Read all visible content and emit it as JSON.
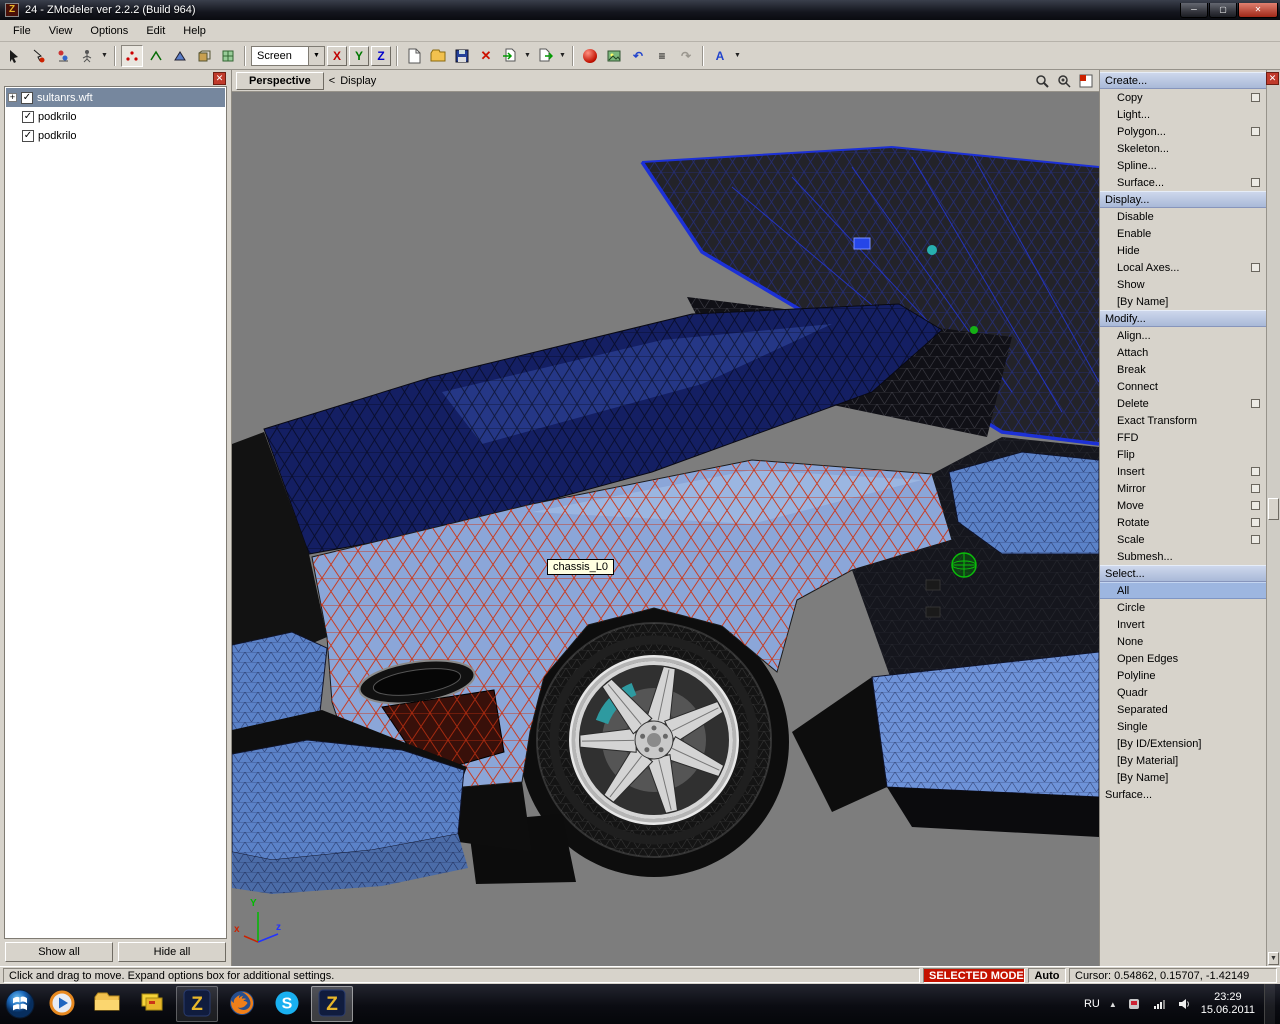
{
  "window": {
    "title": "24 - ZModeler ver 2.2.2 (Build 964)"
  },
  "menu": {
    "items": [
      "File",
      "View",
      "Options",
      "Edit",
      "Help"
    ]
  },
  "toolbar": {
    "screen_mode": "Screen",
    "axis_x": "X",
    "axis_y": "Y",
    "axis_z": "Z",
    "font_button": "A",
    "left_icons": [
      "select-arrow-icon",
      "lasso-select-icon",
      "paint-select-icon",
      "skeleton-pose-icon",
      "vertices-mode-icon",
      "edges-mode-icon",
      "faces-mode-icon",
      "objects-mode-icon",
      "uv-mode-icon"
    ],
    "right_icons": [
      "new-file-icon",
      "open-file-icon",
      "save-file-icon",
      "delete-icon",
      "import-icon",
      "export-icon",
      "material-editor-icon",
      "texture-icon",
      "undo-icon",
      "history-icon",
      "redo-icon",
      "font-icon"
    ]
  },
  "scene_tree": {
    "items": [
      {
        "label": "sultanrs.wft",
        "checked": true,
        "selected": true,
        "expandable": true
      },
      {
        "label": "podkrilo",
        "checked": true
      },
      {
        "label": "podkrilo",
        "checked": true
      }
    ],
    "show_all": "Show all",
    "hide_all": "Hide all"
  },
  "viewport": {
    "view_button": "Perspective",
    "back_arrow": "<",
    "mode_label": "Display",
    "tooltip": "chassis_L0",
    "axis": {
      "x": "x",
      "y": "Y",
      "z": "z"
    },
    "header_icons": [
      "zoom-icon",
      "zoom-extents-icon",
      "viewport-layout-icon"
    ]
  },
  "command_panel": {
    "items": [
      {
        "label": "Create...",
        "header": true
      },
      {
        "label": "Copy",
        "checkbox": true
      },
      {
        "label": "Light..."
      },
      {
        "label": "Polygon...",
        "checkbox": true
      },
      {
        "label": "Skeleton..."
      },
      {
        "label": "Spline..."
      },
      {
        "label": "Surface...",
        "checkbox": true
      },
      {
        "label": "Display...",
        "header": true
      },
      {
        "label": "Disable"
      },
      {
        "label": "Enable"
      },
      {
        "label": "Hide"
      },
      {
        "label": "Local Axes...",
        "checkbox": true
      },
      {
        "label": "Show"
      },
      {
        "label": "[By Name]"
      },
      {
        "label": "Modify...",
        "header": true
      },
      {
        "label": "Align..."
      },
      {
        "label": "Attach"
      },
      {
        "label": "Break"
      },
      {
        "label": "Connect"
      },
      {
        "label": "Delete",
        "checkbox": true
      },
      {
        "label": "Exact Transform"
      },
      {
        "label": "FFD"
      },
      {
        "label": "Flip"
      },
      {
        "label": "Insert",
        "checkbox": true
      },
      {
        "label": "Mirror",
        "checkbox": true
      },
      {
        "label": "Move",
        "checkbox": true
      },
      {
        "label": "Rotate",
        "checkbox": true
      },
      {
        "label": "Scale",
        "checkbox": true
      },
      {
        "label": "Submesh..."
      },
      {
        "label": "Select...",
        "header": true
      },
      {
        "label": "All",
        "selected": true
      },
      {
        "label": "Circle"
      },
      {
        "label": "Invert"
      },
      {
        "label": "None"
      },
      {
        "label": "Open Edges"
      },
      {
        "label": "Polyline"
      },
      {
        "label": "Quadr"
      },
      {
        "label": "Separated"
      },
      {
        "label": "Single"
      },
      {
        "label": "[By ID/Extension]"
      },
      {
        "label": "[By Material]"
      },
      {
        "label": "[By Name]"
      },
      {
        "label": "Surface...",
        "header": true,
        "plain": true
      }
    ]
  },
  "status_bar": {
    "hint": "Click and drag to move. Expand options box for additional settings.",
    "mode": "SELECTED MODE",
    "auto": "Auto",
    "cursor": "Cursor: 0.54862, 0.15707, -1.42149"
  },
  "taskbar": {
    "language": "RU",
    "clock": {
      "time": "23:29",
      "date": "15.06.2011"
    },
    "apps": [
      {
        "name": "media-player"
      },
      {
        "name": "explorer"
      },
      {
        "name": "file-manager"
      },
      {
        "name": "zmodeler",
        "running": true
      },
      {
        "name": "firefox"
      },
      {
        "name": "skype"
      },
      {
        "name": "zmodeler",
        "running": true,
        "focused": true
      }
    ]
  },
  "colors": {
    "selection_header": "#b7c4de",
    "selected_item": "#9db6e0",
    "mode_red": "#c41200",
    "viewport_gray": "#7d7d7d",
    "car_body_blue": "#8ba6d8",
    "wire_red": "#cc3311",
    "wire_blue": "#2233cc"
  }
}
